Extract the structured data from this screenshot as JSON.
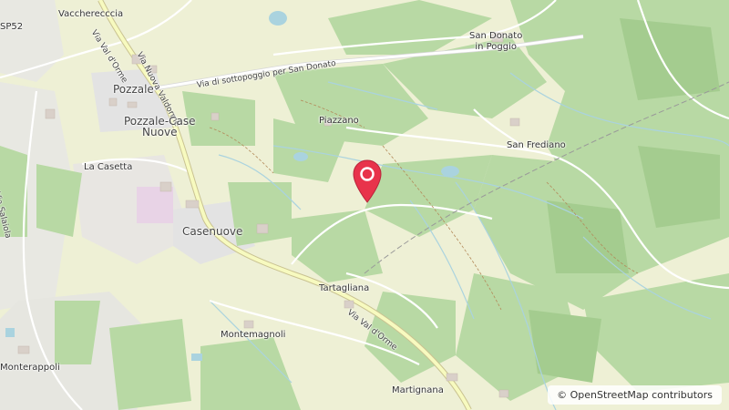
{
  "colors": {
    "forest": "#add19e",
    "farmland": "#eef0d5",
    "residential": "#e0dfdf",
    "water": "#aad3df",
    "road_major": "#f7fabf",
    "road_border": "#c9c291",
    "pin": "#e8334b"
  },
  "labels": {
    "vacchereccia": "Vaccherecccia",
    "sp52": "SP52",
    "pozzale": "Pozzale",
    "pozzale_case_nuove_1": "Pozzale-Case",
    "pozzale_case_nuove_2": "Nuove",
    "la_casetta": "La Casetta",
    "via_salaiola": "Via Salaiola",
    "via_val_dorme_top": "Via Val d'Orme",
    "via_nuova_valdorme": "Via Nuova Valdorme",
    "via_sottopoggio": "Via di sottopoggio per San Donato",
    "san_donato_1": "San Donato",
    "san_donato_2": "in Poggio",
    "piazzano": "Piazzano",
    "san_frediano": "San Frediano",
    "casenuove": "Casenuove",
    "tartagliana": "Tartagliana",
    "via_val_dorme_bottom": "Via Val d'Orme",
    "montemagnoli": "Montemagnoli",
    "monterappoli": "Monterappoli",
    "martignana": "Martignana"
  },
  "marker": {
    "icon": "map-pin-icon"
  },
  "attribution": {
    "symbol": "©",
    "text": "OpenStreetMap contributors"
  }
}
